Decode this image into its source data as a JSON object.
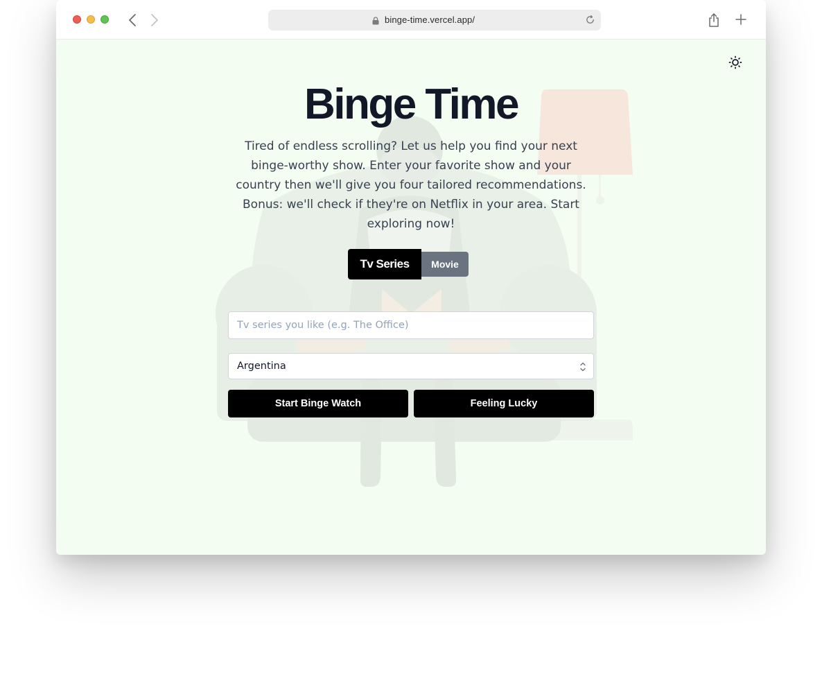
{
  "browser": {
    "url": "binge-time.vercel.app/",
    "icons": [
      "back-icon",
      "forward-icon",
      "lock-icon",
      "reload-icon",
      "share-icon",
      "plus-icon"
    ]
  },
  "page": {
    "title": "Binge Time",
    "description": "Tired of endless scrolling? Let us help you find your next binge-worthy show. Enter your favorite show and your country then we'll give you four tailored recommendations. Bonus: we'll check if they're on Netflix in your area. Start exploring now!",
    "theme_icon": "sun-icon"
  },
  "type_toggle": {
    "options": [
      "Tv Series",
      "Movie"
    ],
    "selected": "Tv Series"
  },
  "search": {
    "placeholder": "Tv series you like (e.g. The Office)",
    "value": ""
  },
  "country": {
    "selected": "Argentina"
  },
  "actions": {
    "start_label": "Start Binge Watch",
    "lucky_label": "Feeling Lucky"
  },
  "colors": {
    "page_background": "#f4fdf2",
    "title": "#111827",
    "primary_button": "#000000",
    "toggle_inactive": "#6b7280"
  }
}
